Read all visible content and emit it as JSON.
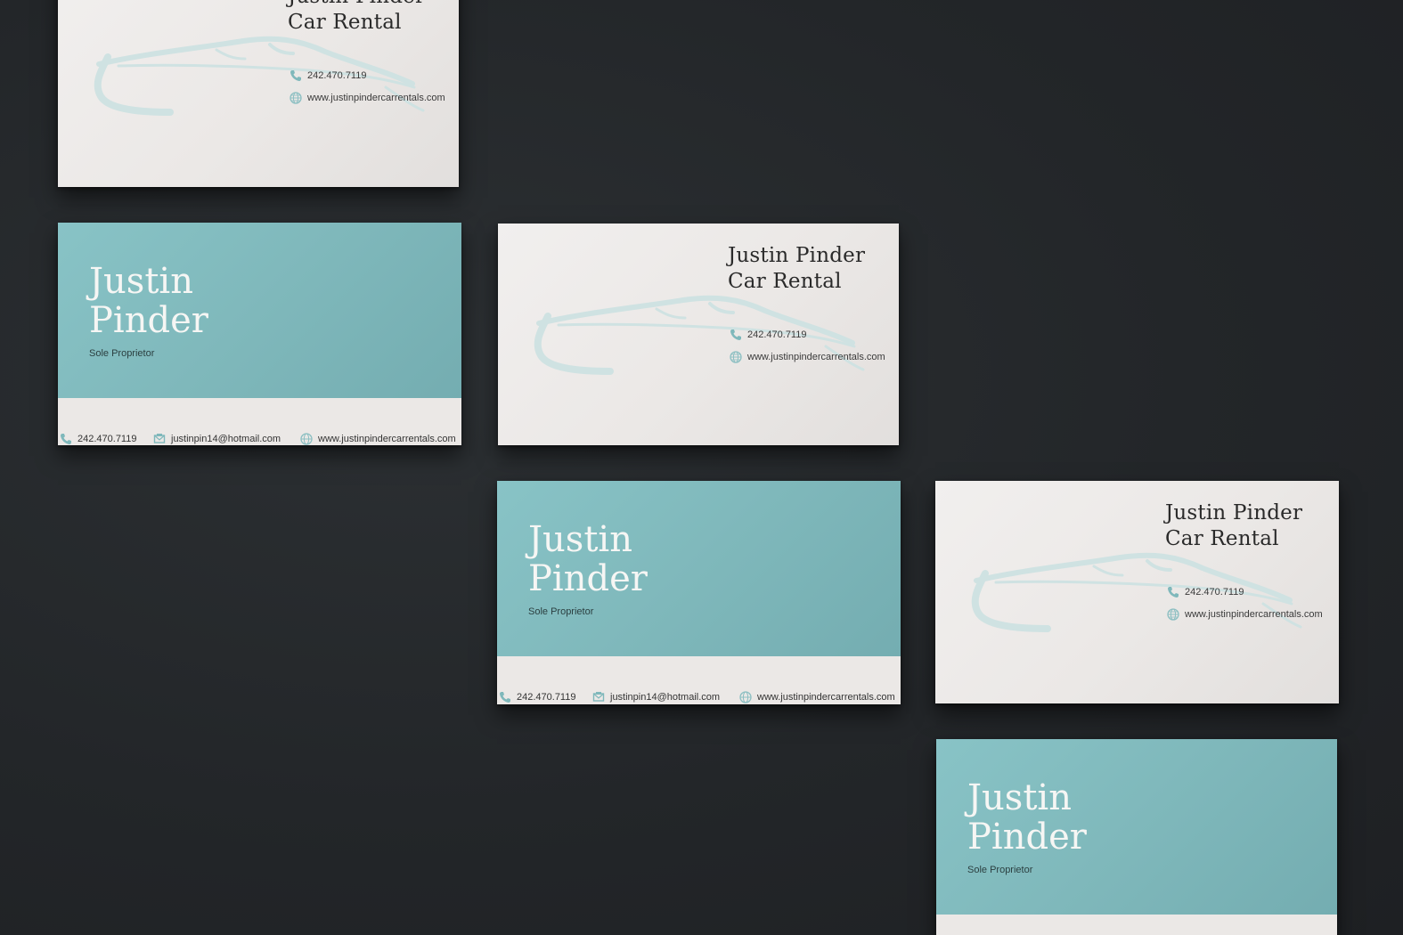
{
  "card_back": {
    "company_line1": "Justin Pinder",
    "company_line2": "Car Rental",
    "phone": "242.470.7119",
    "website": "www.justinpindercarrentals.com"
  },
  "card_front": {
    "name_line1": "Justin",
    "name_line2": "Pinder",
    "role": "Sole Proprietor",
    "phone": "242.470.7119",
    "email": "justinpin14@hotmail.com",
    "website": "www.justinpindercarrentals.com"
  },
  "colors": {
    "background": "#232629",
    "teal": "#7fb8bb",
    "card_paper": "#ebe8e6",
    "text_dark": "#2a2a2a"
  },
  "icons": [
    "phone-icon",
    "globe-icon",
    "envelope-icon",
    "car-silhouette"
  ]
}
